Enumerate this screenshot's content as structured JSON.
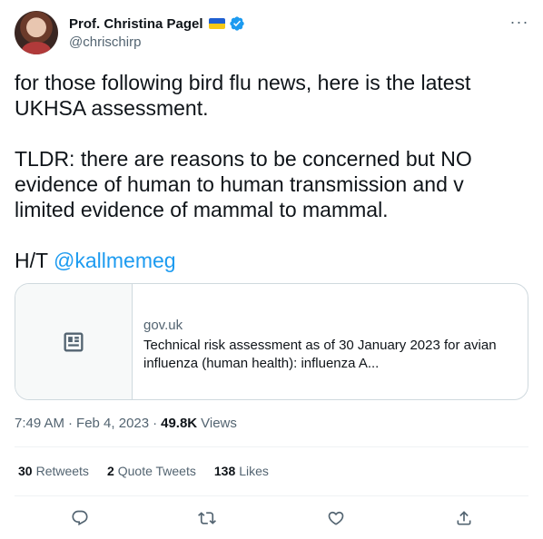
{
  "author": {
    "display_name": "Prof. Christina Pagel",
    "handle": "@chrischirp"
  },
  "menu": {
    "more_label": "···"
  },
  "tweet": {
    "paragraph1": "for those following bird flu news, here is the latest UKHSA assessment.",
    "paragraph2": "TLDR: there are reasons to be concerned but NO evidence of human to human transmission and v limited evidence of mammal to mammal.",
    "paragraph3_prefix": "H/T ",
    "mention": "@kallmemeg"
  },
  "card": {
    "domain": "gov.uk",
    "title": "Technical risk assessment as of 30 January 2023 for avian influenza (human health): influenza A..."
  },
  "meta": {
    "time": "7:49 AM",
    "separator1": "·",
    "date": "Feb 4, 2023",
    "separator2": "·",
    "views_count": "49.8K",
    "views_label": "Views"
  },
  "stats": {
    "retweets_count": "30",
    "retweets_label": "Retweets",
    "quotes_count": "2",
    "quotes_label": "Quote Tweets",
    "likes_count": "138",
    "likes_label": "Likes"
  },
  "icons": {
    "flag": "ukraine-flag-icon",
    "verified": "verified-badge-icon",
    "card": "article-icon",
    "reply": "reply-icon",
    "retweet": "retweet-icon",
    "like": "like-icon",
    "share": "share-icon"
  },
  "colors": {
    "accent": "#1d9bf0",
    "text": "#0f1419",
    "secondary": "#536471",
    "border": "#cfd9de"
  }
}
